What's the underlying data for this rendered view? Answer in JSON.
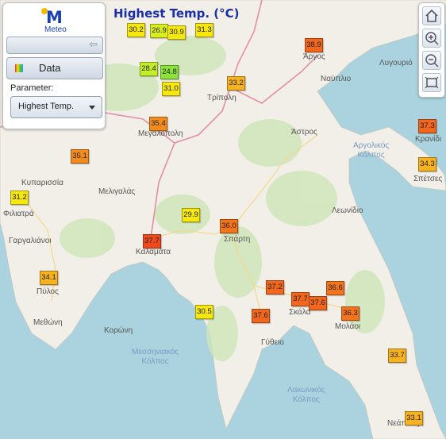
{
  "app": {
    "logo_text": "Meteo",
    "title": "Highest Temp. (°C)"
  },
  "panel": {
    "data_label": "Data",
    "parameter_label": "Parameter:",
    "parameter_value": "Highest Temp."
  },
  "tools": [
    {
      "name": "home-icon"
    },
    {
      "name": "zoom-in-icon"
    },
    {
      "name": "zoom-out-icon"
    },
    {
      "name": "zoom-extent-icon"
    }
  ],
  "colors": {
    "sea": "#aad3df",
    "land": "#f2efe9",
    "forest": "#cde6b8",
    "title": "#1a2fa8"
  },
  "markers": [
    {
      "value": "30.2",
      "color": "#f6e70f"
    },
    {
      "value": "26.9",
      "color": "#d9ee1c"
    },
    {
      "value": "30.9",
      "color": "#f6e70f"
    },
    {
      "value": "31.3",
      "color": "#f6e70f"
    },
    {
      "value": "28.4",
      "color": "#c5ee26"
    },
    {
      "value": "24.8",
      "color": "#8de33a"
    },
    {
      "value": "31.0",
      "color": "#f6e70f"
    },
    {
      "value": "33.2",
      "color": "#f7b21f"
    },
    {
      "value": "38.9",
      "color": "#f2661d"
    },
    {
      "value": "35.4",
      "color": "#f48c1c"
    },
    {
      "value": "35.1",
      "color": "#f48c1c"
    },
    {
      "value": "31.2",
      "color": "#f6e70f"
    },
    {
      "value": "37.3",
      "color": "#f2661d"
    },
    {
      "value": "34.3",
      "color": "#f7b21f"
    },
    {
      "value": "29.9",
      "color": "#f6e70f"
    },
    {
      "value": "36.0",
      "color": "#f4741c"
    },
    {
      "value": "37.7",
      "color": "#ef4a1c"
    },
    {
      "value": "34.1",
      "color": "#f7b21f"
    },
    {
      "value": "37.2",
      "color": "#f2661d"
    },
    {
      "value": "36.6",
      "color": "#f4741c"
    },
    {
      "value": "37.7",
      "color": "#f2661d"
    },
    {
      "value": "37.6",
      "color": "#f2661d"
    },
    {
      "value": "36.3",
      "color": "#f4741c"
    },
    {
      "value": "30.5",
      "color": "#f6e70f"
    },
    {
      "value": "37.6",
      "color": "#f2661d"
    },
    {
      "value": "33.7",
      "color": "#f7b21f"
    },
    {
      "value": "33.1",
      "color": "#f7b21f"
    }
  ],
  "places": [
    "Άργος",
    "Ναύπλιο",
    "Λυγουριό",
    "Τρίπολη",
    "Μεγαλόπολη",
    "Άστρος",
    "Κρανίδι",
    "Σπέτσες",
    "Κυπαρισσία",
    "Μελιγαλάς",
    "Φιλιατρά",
    "Γαργαλιάνοι",
    "Καλαμάτα",
    "Σπάρτη",
    "Λεωνίδιο",
    "Πύλος",
    "Μεθώνη",
    "Κορώνη",
    "Σκάλα",
    "Μολάοι",
    "Γύθειο",
    "Νεάπολη"
  ],
  "seas": [
    {
      "l1": "Αργολικός",
      "l2": "Κόλπος"
    },
    {
      "l1": "Μεσσηνιακός",
      "l2": "Κόλπος"
    },
    {
      "l1": "Λακωνικός",
      "l2": "Κόλπος"
    }
  ]
}
